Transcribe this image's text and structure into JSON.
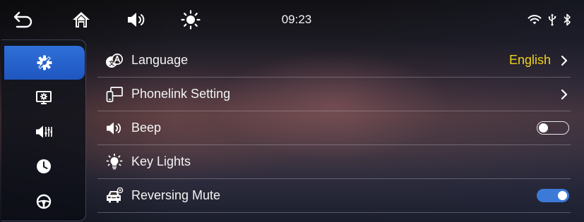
{
  "status_bar": {
    "time": "09:23",
    "icons": [
      "back-icon",
      "home-icon",
      "volume-icon",
      "brightness-icon",
      "wifi-icon",
      "usb-icon",
      "bluetooth-icon"
    ]
  },
  "sidebar": {
    "items": [
      {
        "icon": "settings-gear-icon",
        "active": true
      },
      {
        "icon": "display-settings-icon",
        "active": false
      },
      {
        "icon": "sound-equalizer-icon",
        "active": false
      },
      {
        "icon": "clock-icon",
        "active": false
      },
      {
        "icon": "steering-wheel-icon",
        "active": false
      }
    ],
    "active_color": "#2f6fd8"
  },
  "settings": {
    "rows": [
      {
        "icon": "language-icon",
        "label": "Language",
        "value": "English",
        "control": "chevron"
      },
      {
        "icon": "phonelink-icon",
        "label": "Phonelink Setting",
        "value": "",
        "control": "chevron"
      },
      {
        "icon": "speaker-icon",
        "label": "Beep",
        "control": "toggle",
        "on": false
      },
      {
        "icon": "key-lights-icon",
        "label": "Key Lights",
        "control": "none"
      },
      {
        "icon": "reversing-car-icon",
        "label": "Reversing Mute",
        "control": "toggle",
        "on": true
      }
    ],
    "value_color": "#f0d21e",
    "toggle_on_color": "#3c7ad8"
  }
}
